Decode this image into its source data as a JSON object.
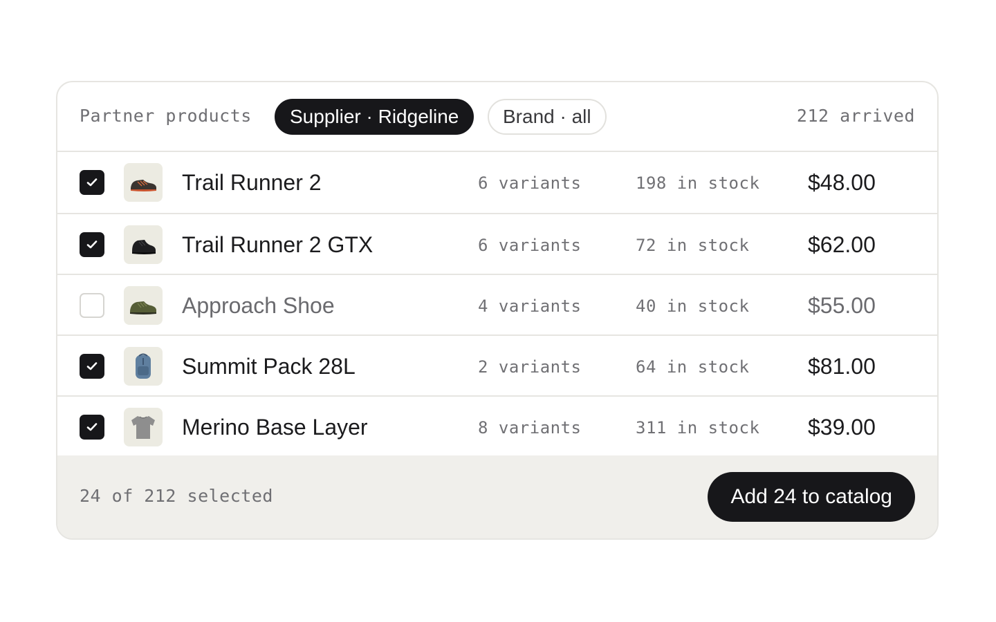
{
  "header": {
    "label": "Partner products",
    "filters": [
      {
        "label": "Supplier · Ridgeline",
        "active": true
      },
      {
        "label": "Brand · all",
        "active": false
      }
    ],
    "count": "212 arrived"
  },
  "products": [
    {
      "name": "Trail Runner 2",
      "variants": "6 variants",
      "stock": "198 in stock",
      "price": "$48.00",
      "selected": true,
      "thumb": "trail-shoe-icon"
    },
    {
      "name": "Trail Runner 2 GTX",
      "variants": "6 variants",
      "stock": "72 in stock",
      "price": "$62.00",
      "selected": true,
      "thumb": "black-shoe-icon"
    },
    {
      "name": "Approach Shoe",
      "variants": "4 variants",
      "stock": "40 in stock",
      "price": "$55.00",
      "selected": false,
      "thumb": "olive-shoe-icon"
    },
    {
      "name": "Summit Pack 28L",
      "variants": "2 variants",
      "stock": "64 in stock",
      "price": "$81.00",
      "selected": true,
      "thumb": "backpack-icon"
    },
    {
      "name": "Merino Base Layer",
      "variants": "8 variants",
      "stock": "311 in stock",
      "price": "$39.00",
      "selected": true,
      "thumb": "shirt-icon"
    }
  ],
  "footer": {
    "selection": "24 of 212 selected",
    "button_label": "Add 24 to catalog"
  },
  "colors": {
    "dark": "#17171a",
    "border": "#e6e5e1",
    "footer_bg": "#f0efeb",
    "muted": "#6f6f73",
    "thumb_bg": "#ecebe2"
  }
}
